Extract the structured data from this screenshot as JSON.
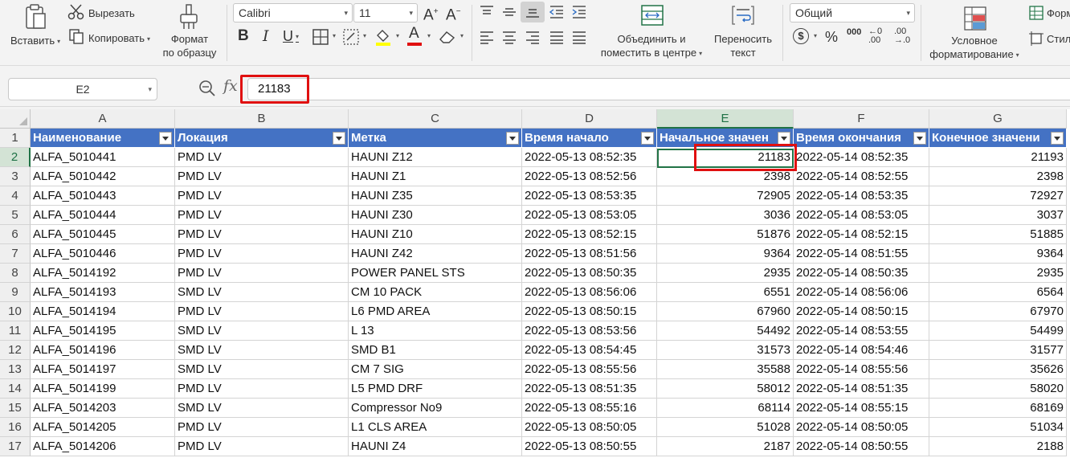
{
  "ribbon": {
    "paste": {
      "label": "Вставить"
    },
    "cut": {
      "label": "Вырезать"
    },
    "copy": {
      "label": "Копировать"
    },
    "format_painter": {
      "line1": "Формат",
      "line2": "по образцу"
    },
    "font_name": "Calibri",
    "font_size": "11",
    "bold": "B",
    "italic": "I",
    "underline": "U",
    "merge": {
      "line1": "Объединить и",
      "line2": "поместить в центре"
    },
    "wrap": {
      "line1": "Переносить",
      "line2": "текст"
    },
    "number_format": "Общий",
    "currency": "$",
    "percent": "%",
    "thousands": "000",
    "conditional": {
      "line1": "Условное",
      "line2": "форматирование"
    },
    "format_table": "Форм",
    "styles": "Стил"
  },
  "formula_bar": {
    "name_box": "E2",
    "fx": "fx",
    "value": "21183"
  },
  "grid": {
    "columns": [
      "A",
      "B",
      "C",
      "D",
      "E",
      "F",
      "G"
    ],
    "row_numbers": [
      "1",
      "2",
      "3",
      "4",
      "5",
      "6",
      "7",
      "8",
      "9",
      "10",
      "11",
      "12",
      "13",
      "14",
      "15",
      "16",
      "17"
    ],
    "headers": [
      "Наименование",
      "Локация",
      "Метка",
      "Время начало",
      "Начальное значен",
      "Время окончания",
      "Конечное значени"
    ],
    "rows": [
      [
        "ALFA_5010441",
        "PMD LV",
        "HAUNI Z12",
        "2022-05-13 08:52:35",
        "21183",
        "2022-05-14 08:52:35",
        "21193"
      ],
      [
        "ALFA_5010442",
        "PMD LV",
        "HAUNI Z1",
        "2022-05-13 08:52:56",
        "2398",
        "2022-05-14 08:52:55",
        "2398"
      ],
      [
        "ALFA_5010443",
        "PMD LV",
        "HAUNI Z35",
        "2022-05-13 08:53:35",
        "72905",
        "2022-05-14 08:53:35",
        "72927"
      ],
      [
        "ALFA_5010444",
        "PMD LV",
        "HAUNI Z30",
        "2022-05-13 08:53:05",
        "3036",
        "2022-05-14 08:53:05",
        "3037"
      ],
      [
        "ALFA_5010445",
        "PMD LV",
        "HAUNI Z10",
        "2022-05-13 08:52:15",
        "51876",
        "2022-05-14 08:52:15",
        "51885"
      ],
      [
        "ALFA_5010446",
        "PMD LV",
        "HAUNI Z42",
        "2022-05-13 08:51:56",
        "9364",
        "2022-05-14 08:51:55",
        "9364"
      ],
      [
        "ALFA_5014192",
        "PMD LV",
        "POWER PANEL STS",
        "2022-05-13 08:50:35",
        "2935",
        "2022-05-14 08:50:35",
        "2935"
      ],
      [
        "ALFA_5014193",
        "SMD LV",
        "CM 10 PACK",
        "2022-05-13 08:56:06",
        "6551",
        "2022-05-14 08:56:06",
        "6564"
      ],
      [
        "ALFA_5014194",
        "PMD LV",
        "L6 PMD AREA",
        "2022-05-13 08:50:15",
        "67960",
        "2022-05-14 08:50:15",
        "67970"
      ],
      [
        "ALFA_5014195",
        "SMD LV",
        "L 13",
        "2022-05-13 08:53:56",
        "54492",
        "2022-05-14 08:53:55",
        "54499"
      ],
      [
        "ALFA_5014196",
        "SMD LV",
        "SMD B1",
        "2022-05-13 08:54:45",
        "31573",
        "2022-05-14 08:54:46",
        "31577"
      ],
      [
        "ALFA_5014197",
        "SMD LV",
        "CM 7 SIG",
        "2022-05-13 08:55:56",
        "35588",
        "2022-05-14 08:55:56",
        "35626"
      ],
      [
        "ALFA_5014199",
        "PMD LV",
        "L5 PMD DRF",
        "2022-05-13 08:51:35",
        "58012",
        "2022-05-14 08:51:35",
        "58020"
      ],
      [
        "ALFA_5014203",
        "SMD LV",
        "Compressor No9",
        "2022-05-13 08:55:16",
        "68114",
        "2022-05-14 08:55:15",
        "68169"
      ],
      [
        "ALFA_5014205",
        "PMD LV",
        "L1 CLS AREA",
        "2022-05-13 08:50:05",
        "51028",
        "2022-05-14 08:50:05",
        "51034"
      ],
      [
        "ALFA_5014206",
        "PMD LV",
        "HAUNI Z4",
        "2022-05-13 08:50:55",
        "2187",
        "2022-05-14 08:50:55",
        "2188"
      ]
    ]
  },
  "colors": {
    "header_fill": "#4472c4",
    "selection_green": "#217346",
    "highlight_red": "#e01010"
  }
}
